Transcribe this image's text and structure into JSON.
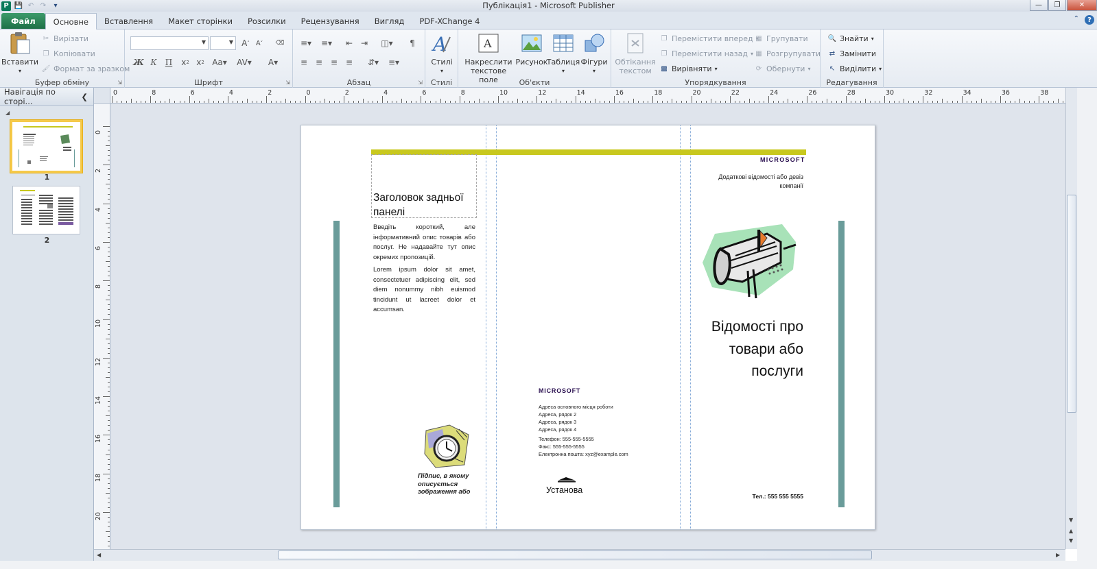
{
  "window": {
    "title": "Публікація1  -  Microsoft Publisher",
    "app_icon": "P",
    "controls": [
      "minimize-icon",
      "restore-icon",
      "close-icon"
    ]
  },
  "tabs": [
    {
      "label": "Файл"
    },
    {
      "label": "Основне"
    },
    {
      "label": "Вставлення"
    },
    {
      "label": "Макет сторінки"
    },
    {
      "label": "Розсилки"
    },
    {
      "label": "Рецензування"
    },
    {
      "label": "Вигляд"
    },
    {
      "label": "PDF-XChange 4"
    }
  ],
  "ribbon": {
    "clipboard": {
      "label": "Буфер обміну",
      "paste": "Вставити",
      "cut": "Вирізати",
      "copy": "Копіювати",
      "format_painter": "Формат за зразком"
    },
    "font": {
      "label": "Шрифт",
      "font_name": "",
      "font_size": "",
      "bold": "Ж",
      "italic": "К",
      "underline": "П"
    },
    "paragraph": {
      "label": "Абзац"
    },
    "styles": {
      "label": "Стилі",
      "button": "Стилі"
    },
    "objects": {
      "label": "Об'єкти",
      "draw_textbox": "Накреслити текстове поле",
      "picture": "Рисунок",
      "table": "Таблиця",
      "shapes": "Фігури"
    },
    "arrange": {
      "label": "Упорядкування",
      "wrap_text": "Обтікання текстом",
      "bring_forward": "Перемістити вперед",
      "send_backward": "Перемістити назад",
      "align": "Вирівняти",
      "group": "Групувати",
      "ungroup": "Розгрупувати",
      "rotate": "Обернути"
    },
    "editing": {
      "label": "Редагування",
      "find": "Знайти",
      "replace": "Замінити",
      "select": "Виділити"
    }
  },
  "nav_pane": {
    "title": "Навігація по сторі...",
    "pages": [
      {
        "number": "1",
        "selected": true
      },
      {
        "number": "2",
        "selected": false
      }
    ]
  },
  "ruler": {
    "top_numbers": [
      "0",
      "8",
      "6",
      "4",
      "2",
      "0",
      "2",
      "4",
      "6",
      "8",
      "10",
      "12",
      "14",
      "16",
      "18",
      "20",
      "22",
      "24",
      "26",
      "28",
      "30",
      "32",
      "34",
      "36",
      "38"
    ],
    "left_numbers": [
      "0",
      "2",
      "4",
      "6",
      "8",
      "10",
      "12",
      "14",
      "16",
      "18",
      "20"
    ]
  },
  "document": {
    "back_panel_title": "Заголовок задньої панелі",
    "body_para1": "Введіть короткий, але інформативний опис товарів або послуг. Не надавайте тут опис окремих пропозицій.",
    "body_para2": "Lorem ipsum dolor sit amet, consectetuer adipiscing elit, sed diem nonummy nibh euismod tincidunt ut lacreet dolor et accumsan.",
    "caption": "Підпис, в якому описується зображення або",
    "company_top": "MICROSOFT",
    "tagline": "Додаткові відомості або девіз компанії",
    "main_title": "Відомості про товари або послуги",
    "company_mid": "MICROSOFT",
    "address_lines": [
      "Адреса основного місця роботи",
      "Адреса, рядок 2",
      "Адреса, рядок 3",
      "Адреса, рядок 4"
    ],
    "contact_lines": [
      "Телефон: 555-555-5555",
      "Факс: 555-555-5555",
      "Електронна пошта: xyz@example.com"
    ],
    "org_name": "Установа",
    "phone": "Тел.: 555 555 5555",
    "colors": {
      "accent_bar": "#c8c81e",
      "side_bar": "#6a9c9a",
      "company": "#2a1050"
    }
  }
}
